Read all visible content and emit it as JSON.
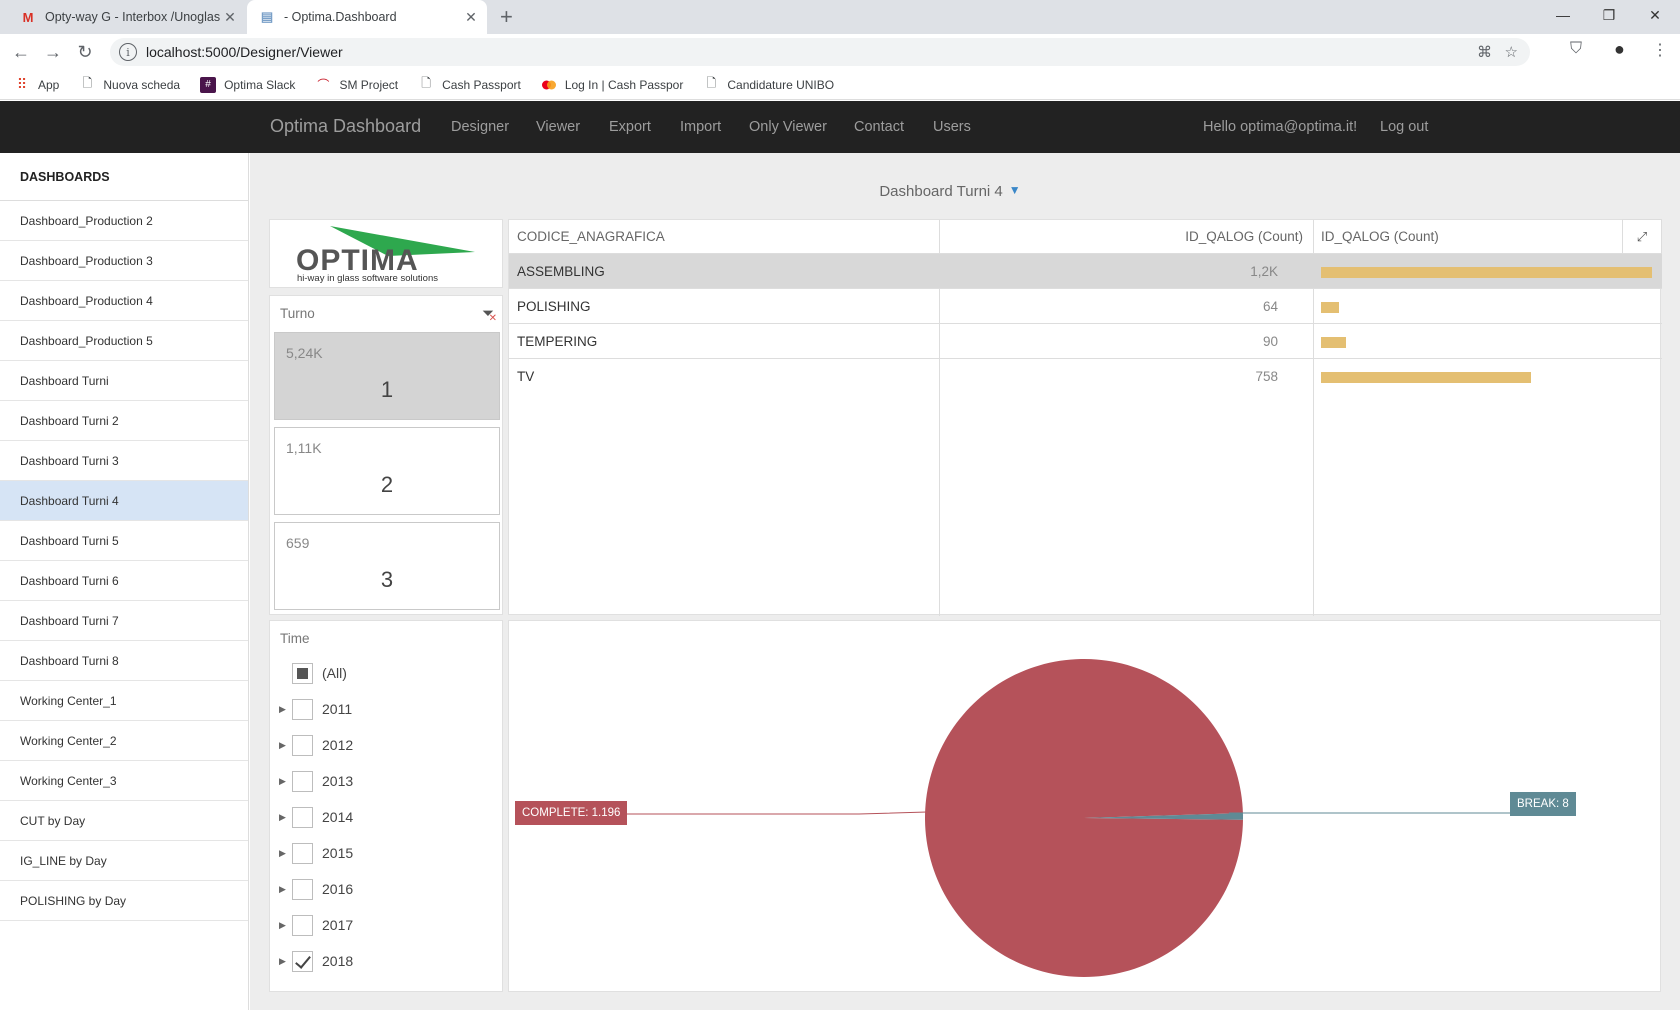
{
  "browser": {
    "tabs": [
      {
        "title": "Opty-way G - Interbox /Unoglass",
        "icon": "gmail-icon"
      },
      {
        "title": "- Optima.Dashboard",
        "icon": "page-icon"
      }
    ],
    "url": "localhost:5000/Designer/Viewer",
    "bookmarks": [
      {
        "label": "App",
        "icon": "apps-grid-icon"
      },
      {
        "label": "Nuova scheda",
        "icon": "page-icon"
      },
      {
        "label": "Optima Slack",
        "icon": "slack-icon"
      },
      {
        "label": "SM Project",
        "icon": "sm-project-icon"
      },
      {
        "label": "Cash Passport",
        "icon": "page-icon"
      },
      {
        "label": "Log In | Cash Passpor",
        "icon": "mastercard-icon"
      },
      {
        "label": "Candidature UNIBO",
        "icon": "page-icon"
      }
    ]
  },
  "nav": {
    "brand": "Optima Dashboard",
    "items": [
      "Designer",
      "Viewer",
      "Export",
      "Import",
      "Only Viewer",
      "Contact",
      "Users"
    ],
    "user": "Hello optima@optima.it!",
    "logout": "Log out"
  },
  "sidebar": {
    "title": "DASHBOARDS",
    "items": [
      "Dashboard_Production 2",
      "Dashboard_Production 3",
      "Dashboard_Production 4",
      "Dashboard_Production 5",
      "Dashboard Turni",
      "Dashboard Turni 2",
      "Dashboard Turni 3",
      "Dashboard Turni 4",
      "Dashboard Turni 5",
      "Dashboard Turni 6",
      "Dashboard Turni 7",
      "Dashboard Turni 8",
      "Working Center_1",
      "Working Center_2",
      "Working Center_3",
      "CUT by Day",
      "IG_LINE by Day",
      "POLISHING by Day"
    ],
    "active_index": 7
  },
  "dashboard": {
    "title": "Dashboard Turni 4",
    "logo": {
      "name": "OPTIMA",
      "tagline": "hi-way in glass software solutions"
    },
    "turno": {
      "caption": "Turno",
      "tiles": [
        {
          "value": "5,24K",
          "label": "1",
          "selected": true
        },
        {
          "value": "1,11K",
          "label": "2",
          "selected": false
        },
        {
          "value": "659",
          "label": "3",
          "selected": false
        }
      ]
    },
    "grid": {
      "columns": [
        "CODICE_ANAGRAFICA",
        "ID_QALOG (Count)",
        "ID_QALOG (Count)"
      ],
      "rows": [
        {
          "name": "ASSEMBLING",
          "value": "1,2K",
          "count": 1196
        },
        {
          "name": "POLISHING",
          "value": "64",
          "count": 64
        },
        {
          "name": "TEMPERING",
          "value": "90",
          "count": 90
        },
        {
          "name": "TV",
          "value": "758",
          "count": 758
        }
      ],
      "bar_color": "#e4bf72"
    },
    "time": {
      "caption": "Time",
      "all_label": "(All)",
      "years": [
        {
          "label": "2011",
          "checked": false
        },
        {
          "label": "2012",
          "checked": false
        },
        {
          "label": "2013",
          "checked": false
        },
        {
          "label": "2014",
          "checked": false
        },
        {
          "label": "2015",
          "checked": false
        },
        {
          "label": "2016",
          "checked": false
        },
        {
          "label": "2017",
          "checked": false
        },
        {
          "label": "2018",
          "checked": true
        }
      ]
    },
    "pie": {
      "slices": [
        {
          "label": "COMPLETE: 1.196",
          "value": 1196,
          "color": "#b5525a"
        },
        {
          "label": "BREAK: 8",
          "value": 8,
          "color": "#5f8a95"
        }
      ]
    }
  }
}
